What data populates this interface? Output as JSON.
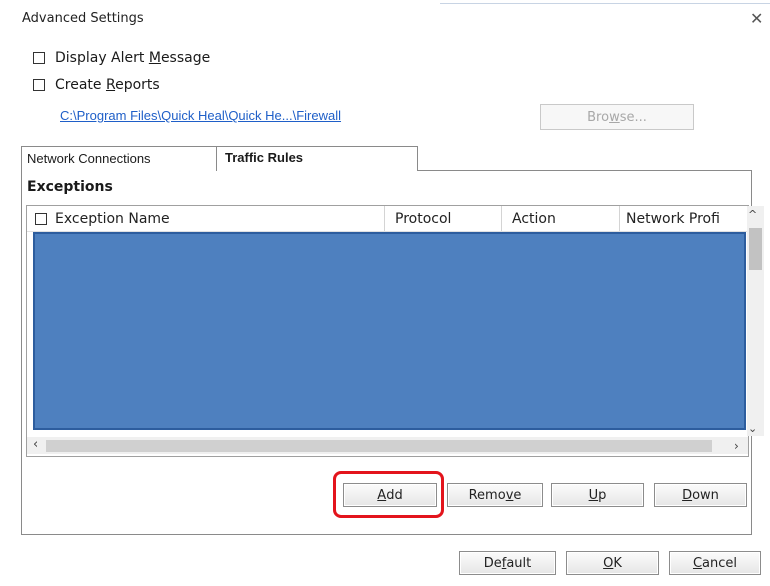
{
  "window": {
    "title": "Advanced Settings"
  },
  "options": {
    "display_alert_pre": "Display Alert ",
    "display_alert_key": "M",
    "display_alert_post": "essage",
    "create_reports_pre": "Create ",
    "create_reports_key": "R",
    "create_reports_post": "eports"
  },
  "path": {
    "text": "C:\\Program Files\\Quick Heal\\Quick He...\\Firewall"
  },
  "browse": {
    "pre": "Bro",
    "key": "w",
    "post": "se..."
  },
  "tabs": [
    {
      "label": "Network Connections",
      "active": false
    },
    {
      "label": "Traffic Rules",
      "active": true
    }
  ],
  "exceptions": {
    "title": "Exceptions",
    "columns": [
      "Exception Name",
      "Protocol",
      "Action",
      "Network Profi"
    ]
  },
  "buttons": {
    "add_key": "A",
    "add_rest": "dd",
    "remove_pre": "Remo",
    "remove_key": "v",
    "remove_post": "e",
    "up_key": "U",
    "up_rest": "p",
    "down_key": "D",
    "down_rest": "own",
    "default_pre": "De",
    "default_key": "f",
    "default_post": "ault",
    "ok_key": "O",
    "ok_rest": "K",
    "cancel_key": "C",
    "cancel_rest": "ancel"
  },
  "colors": {
    "selection": "#4e80bf",
    "highlight": "#e3141c",
    "link": "#1f5fc8"
  },
  "icons": {
    "close": "close-icon",
    "scroll_up": "chevron-up-icon",
    "scroll_down": "chevron-down-icon",
    "scroll_left": "chevron-left-icon",
    "scroll_right": "chevron-right-icon"
  }
}
